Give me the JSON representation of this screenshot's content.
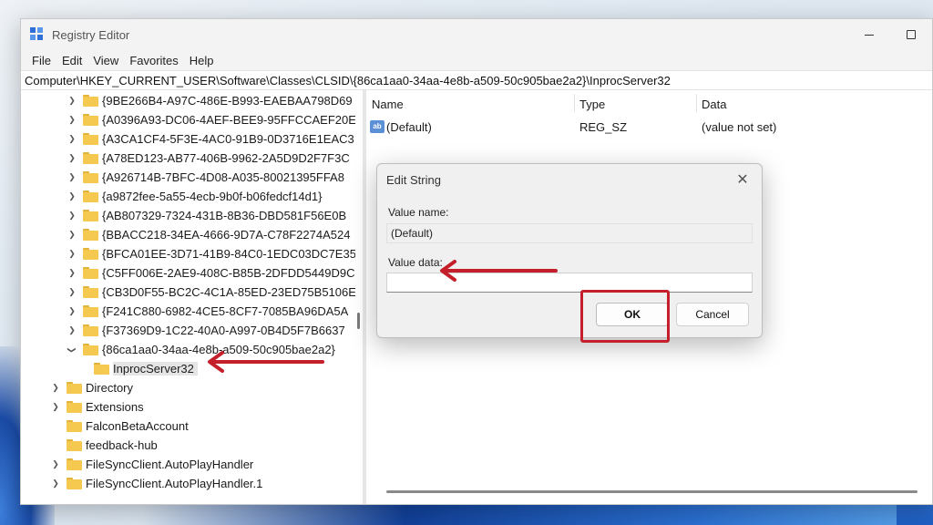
{
  "window": {
    "title": "Registry Editor"
  },
  "menu": [
    "File",
    "Edit",
    "View",
    "Favorites",
    "Help"
  ],
  "address": "Computer\\HKEY_CURRENT_USER\\Software\\Classes\\CLSID\\{86ca1aa0-34aa-4e8b-a509-50c905bae2a2}\\InprocServer32",
  "tree": {
    "clsid_children": [
      "{9BE266B4-A97C-486E-B993-EAEBAA798D69",
      "{A0396A93-DC06-4AEF-BEE9-95FFCCAEF20E",
      "{A3CA1CF4-5F3E-4AC0-91B9-0D3716E1EAC3",
      "{A78ED123-AB77-406B-9962-2A5D9D2F7F3C",
      "{A926714B-7BFC-4D08-A035-80021395FFA8",
      "{a9872fee-5a55-4ecb-9b0f-b06fedcf14d1}",
      "{AB807329-7324-431B-8B36-DBD581F56E0B",
      "{BBACC218-34EA-4666-9D7A-C78F2274A524",
      "{BFCA01EE-3D71-41B9-84C0-1EDC03DC7E35",
      "{C5FF006E-2AE9-408C-B85B-2DFDD5449D9C",
      "{CB3D0F55-BC2C-4C1A-85ED-23ED75B5106E",
      "{F241C880-6982-4CE5-8CF7-7085BA96DA5A",
      "{F37369D9-1C22-40A0-A997-0B4D5F7B6637"
    ],
    "expanded_key": "{86ca1aa0-34aa-4e8b-a509-50c905bae2a2}",
    "selected_key": "InprocServer32",
    "classes_children": [
      "Directory",
      "Extensions",
      "FalconBetaAccount",
      "feedback-hub",
      "FileSyncClient.AutoPlayHandler",
      "FileSyncClient.AutoPlayHandler.1"
    ]
  },
  "values": {
    "headers": {
      "name": "Name",
      "type": "Type",
      "data": "Data"
    },
    "rows": [
      {
        "name": "(Default)",
        "type": "REG_SZ",
        "data": "(value not set)",
        "icon": "ab-string-icon"
      }
    ]
  },
  "dialog": {
    "title": "Edit String",
    "value_name_label": "Value name:",
    "value_name": "(Default)",
    "value_data_label": "Value data:",
    "value_data": "",
    "ok_label": "OK",
    "cancel_label": "Cancel"
  },
  "annotations": {
    "color": "#c41f2b"
  }
}
